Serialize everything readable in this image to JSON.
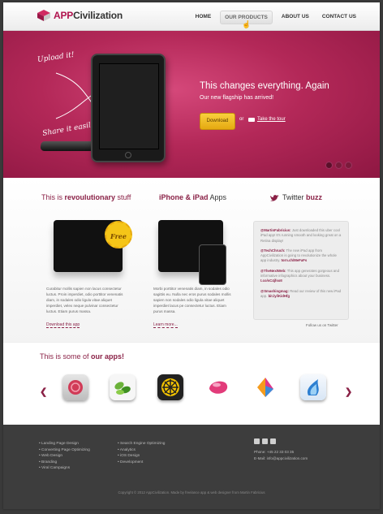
{
  "header": {
    "logo_prefix": "APP",
    "logo_suffix": "Civilization",
    "nav": [
      {
        "label": "HOME",
        "active": false
      },
      {
        "label": "OUR PRODUCTS",
        "active": true
      },
      {
        "label": "ABOUT US",
        "active": false
      },
      {
        "label": "CONTACT US",
        "active": false
      }
    ]
  },
  "hero": {
    "note_upload": "Upload it!",
    "note_share": "Share it easily!",
    "title": "This changes everything. Again",
    "subtitle": "Our new flagship has arrived!",
    "download_label": "Download",
    "or_text": "or",
    "tour_label": "Take the tour",
    "slides": 3,
    "active_slide": 1
  },
  "features": {
    "col1": {
      "prefix": "This is ",
      "highlight": "revoulutionary",
      "suffix": " stuff"
    },
    "col2": {
      "highlight": "iPhone & iPad",
      "suffix": " Apps"
    },
    "col3": {
      "prefix": "Twitter ",
      "highlight": "buzz"
    },
    "badge": "Free",
    "desc1": "Curabitur mollis sapien non lacus consectetur luctus. Proin imperdiet, odio porttitor venenatis diam, in sodales odio ligula vitae aliquet imperdiet, velex neque pulvinar consectetur luctus. Etiam purus massa.",
    "desc2": "Morbi porttitor venenatis diam, in sodales odio sagittis eu. Nulla nec eros purus sodales mollis sapien non sodales odio ligula vitae aliquet imperdiet lacus pe consectetur luctus. Etiam purus massa.",
    "link1": "Download this app",
    "link2": "Learn more...",
    "tweets": [
      {
        "handle": "@MartinFabricius:",
        "text": " Just downloaded this uber cool iPad app! It's running smooth and looking great on a Retina display!",
        "link": ""
      },
      {
        "handle": "@TechChruch:",
        "text": " The new iPad app from AppCivilization is going to revolutionize the whole app industry. ",
        "link": "torn.ch/MeFaFs"
      },
      {
        "handle": "@TheNextWeb:",
        "text": " This app generates gorgeous and informative infographics about your business. ",
        "link": "t.co/sC4jfsoII"
      },
      {
        "handle": "@Smashingmag:",
        "text": " Read our review of this new iPad app. ",
        "link": "bit.ly/iKidHfg"
      }
    ],
    "follow": "Follow us on Twitter"
  },
  "apps": {
    "title_prefix": "This is some of ",
    "title_highlight": "our apps!",
    "icons": [
      {
        "name": "rose-app-icon",
        "color": "#d8d8d8"
      },
      {
        "name": "leaf-app-icon",
        "color": "#f4f4f4"
      },
      {
        "name": "wheel-app-icon",
        "color": "#222222"
      },
      {
        "name": "pink-shape-app-icon",
        "color": "#e23b7a"
      },
      {
        "name": "bird-app-icon",
        "color": "#f2f2f2"
      },
      {
        "name": "flame-app-icon",
        "color": "#eef4fb"
      }
    ]
  },
  "footer": {
    "list1": [
      "Landing Page Design",
      "Converting Page Optimizing",
      "Web Design",
      "Branding",
      "Viral Campaigns"
    ],
    "list2": [
      "Search Engine Optimizing",
      "Analytics",
      "iOS Design",
      "Development"
    ],
    "phone": "Phone: +45 22 33 03 35",
    "email": "E-Mail: info@appcivilization.com",
    "copyright": "Copyright © 2012 AppCivilization. Made by freelance app & web designer from Martin Fabricius"
  },
  "colors": {
    "brand": "#8a2146",
    "hero": "#b32858",
    "button": "#f1bd25",
    "footer": "#3d3d3d"
  }
}
